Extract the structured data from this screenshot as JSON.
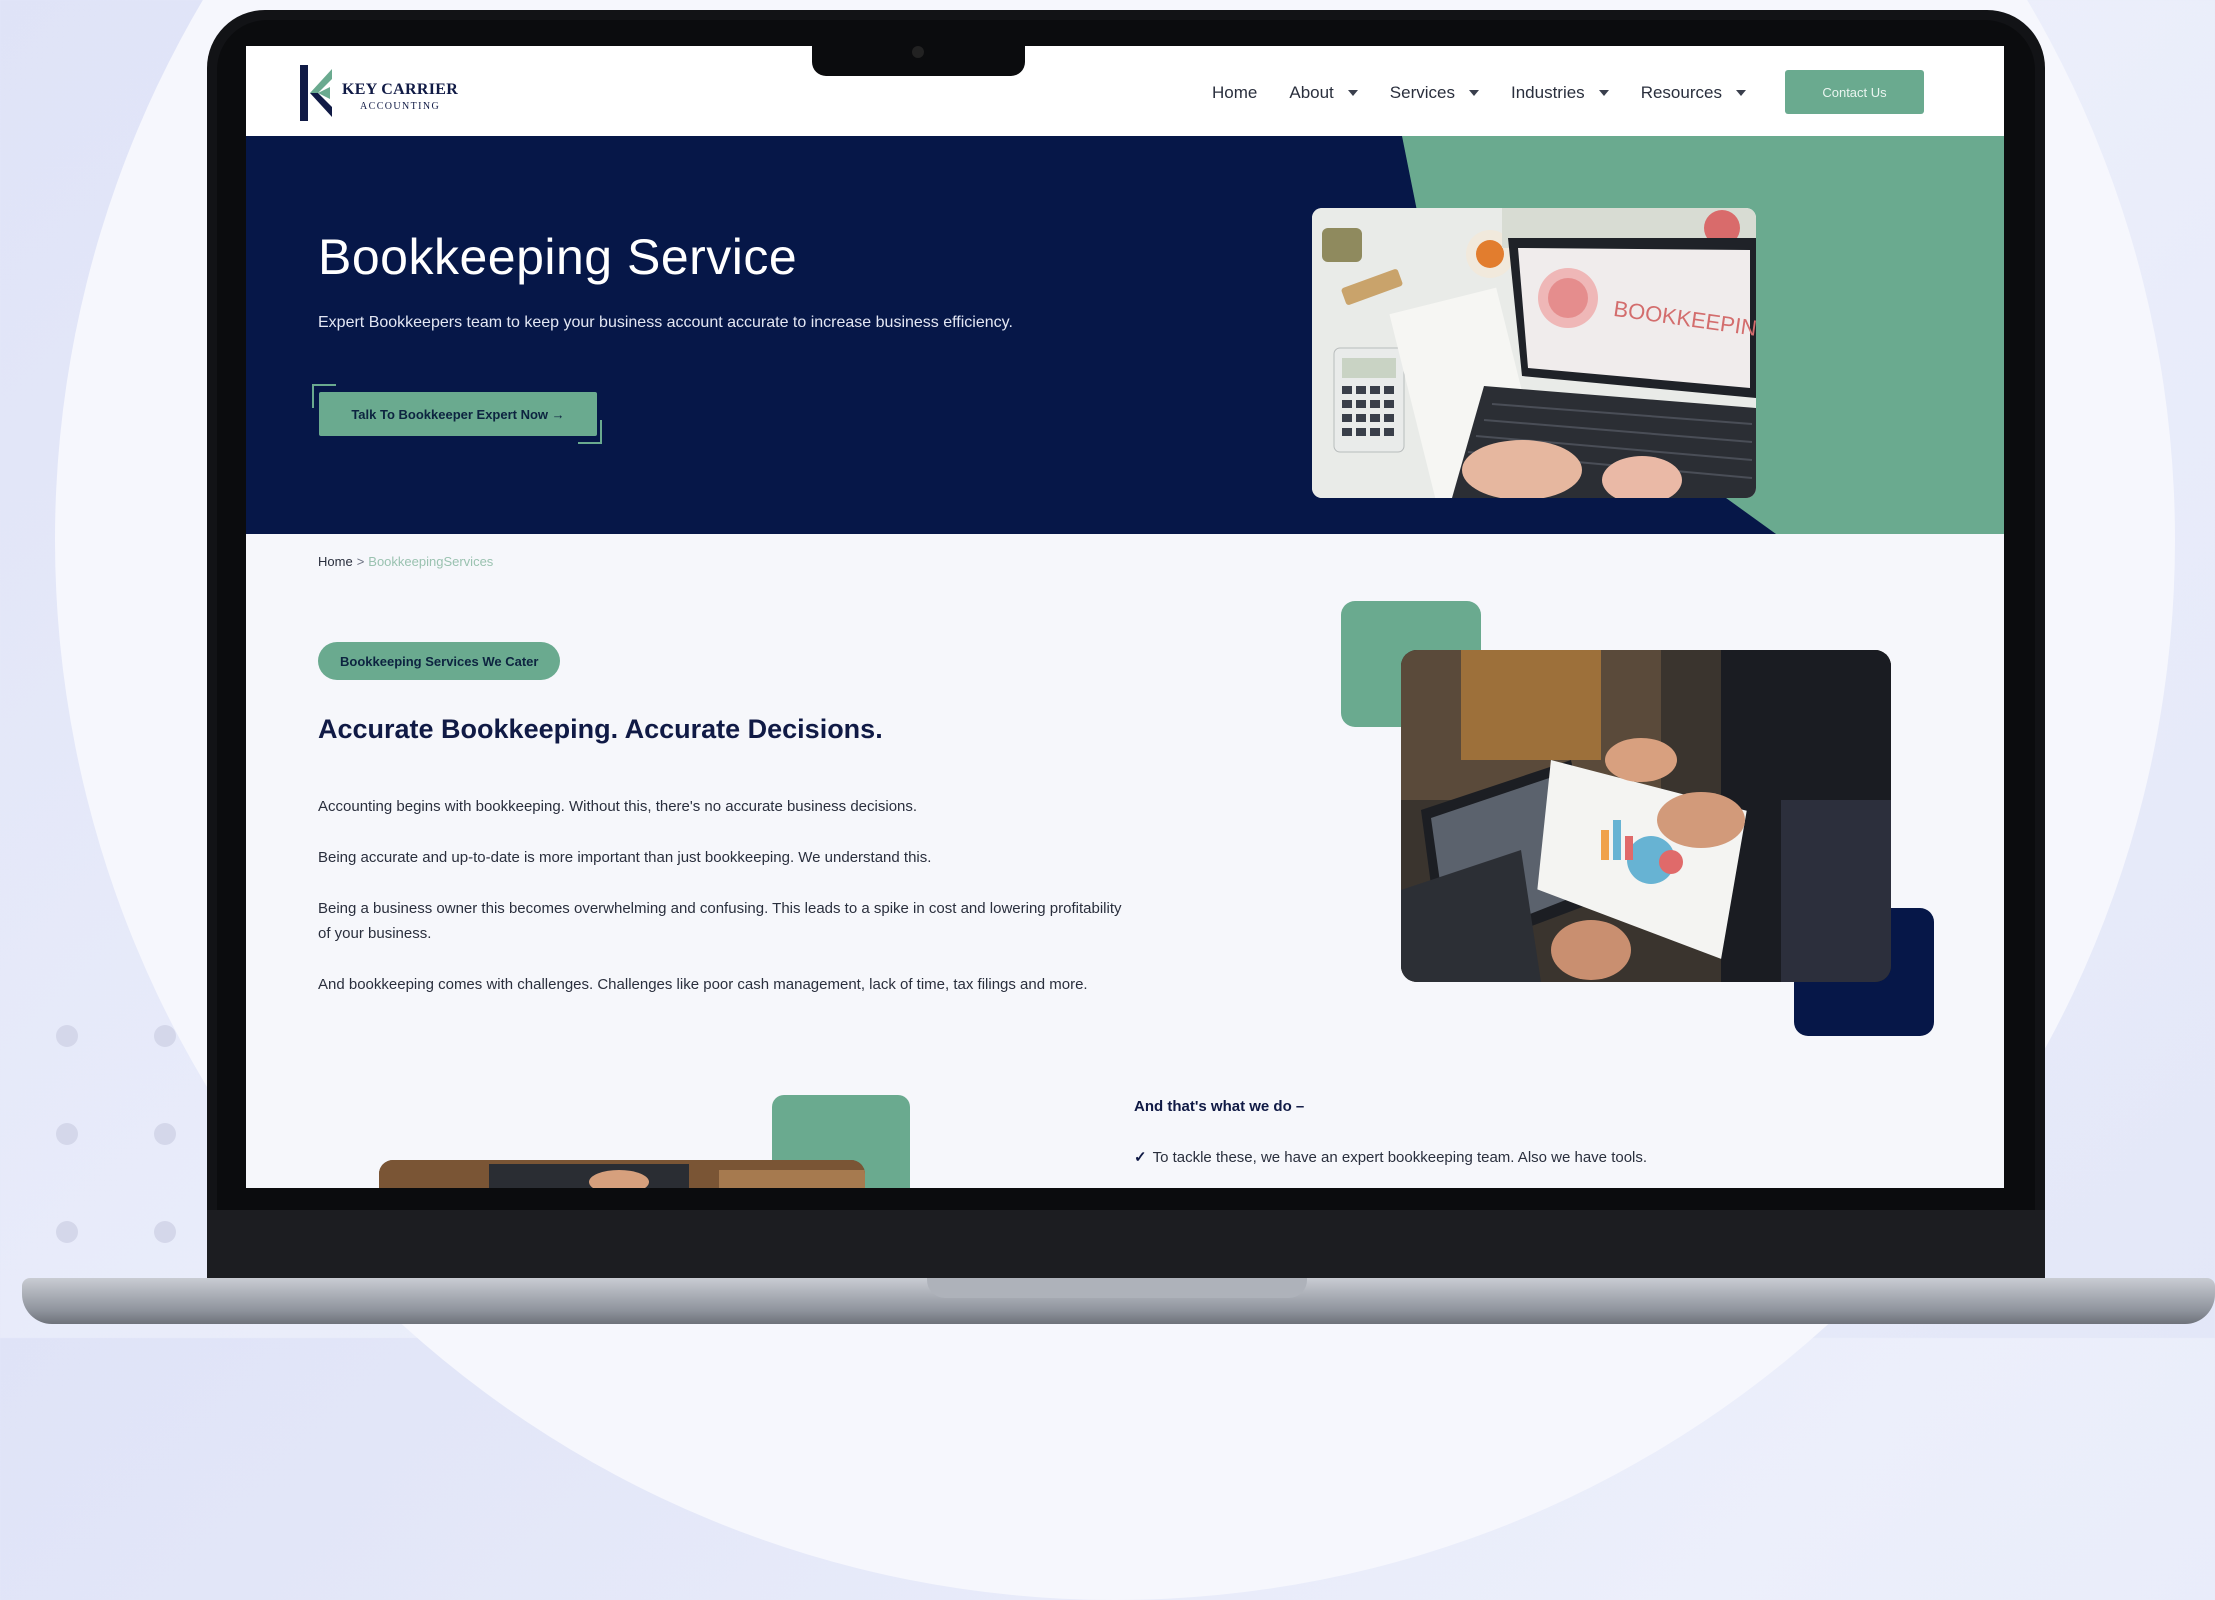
{
  "colors": {
    "navy": "#061748",
    "accent_green": "#6aaa8f",
    "page_background": "#f6f7fb"
  },
  "header": {
    "logo": {
      "line1": "KEY CARRIER",
      "line2": "ACCOUNTING",
      "icon": "key-carrier-k-logo-icon"
    },
    "nav": [
      {
        "label": "Home",
        "has_dropdown": false
      },
      {
        "label": "About",
        "has_dropdown": true
      },
      {
        "label": "Services",
        "has_dropdown": true
      },
      {
        "label": "Industries",
        "has_dropdown": true
      },
      {
        "label": "Resources",
        "has_dropdown": true
      }
    ],
    "contact_button": "Contact Us"
  },
  "hero": {
    "title": "Bookkeeping Service",
    "subtitle": "Expert Bookkeepers team to keep your business account accurate to increase business efficiency.",
    "cta_label": "Talk To Bookkeeper Expert Now →",
    "image_screen_text": "BOOKKEEPING"
  },
  "breadcrumb": {
    "home": "Home",
    "separator": ">",
    "current": "BookkeepingServices"
  },
  "content": {
    "badge": "Bookkeeping Services We Cater",
    "title": "Accurate Bookkeeping. Accurate Decisions.",
    "paragraphs": [
      "Accounting begins with bookkeeping. Without this, there's no accurate business decisions.",
      "Being accurate and up-to-date is more important than just bookkeeping. We understand this.",
      "Being a business owner this becomes overwhelming and confusing. This leads to a spike in cost and lowering profitability of your business.",
      "And bookkeeping comes with challenges. Challenges like poor cash management, lack of time, tax filings and more."
    ]
  },
  "what_we_do": {
    "heading": "And that's what we do –",
    "items": [
      {
        "check": "✓",
        "text": "To tackle these, we have an expert bookkeeping team. Also we have tools."
      }
    ]
  }
}
